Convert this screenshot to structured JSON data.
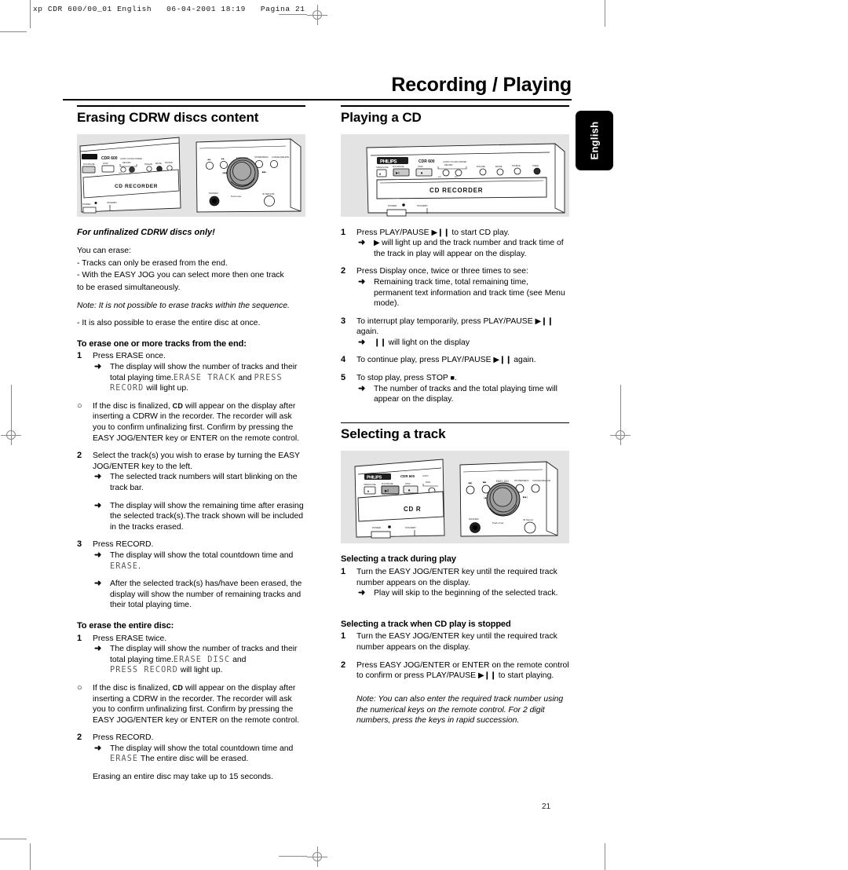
{
  "print_slug": "xp CDR 600/00_01 English   06-04-2001 18:19   Pagina 21",
  "running_head": "Recording / Playing",
  "language_tab": "English",
  "folio": "21",
  "left_column": {
    "section_title": "Erasing CDRW  discs content",
    "figure_name": "cd-recorder-front-panel-split-view",
    "lead": "For unfinalized CDRW discs only!",
    "intro_lines": [
      "You can erase:",
      "- Tracks can only be erased from the end.",
      "- With the EASY JOG you can select more then one track",
      "   to be erased simultaneously."
    ],
    "note_1": "Note: It is not possible to erase tracks within the sequence.",
    "intro_last": "- It is also possible to erase the entire disc at once.",
    "sub_1": "To erase one or more tracks from the end:",
    "s1_num": "1",
    "s1_text": "Press ERASE once.",
    "s1_a_pre": "The display will show the number of tracks and their total playing time.",
    "s1_a_lcd1": "ERASE TRACK",
    "s1_a_mid": " and ",
    "s1_a_lcd2": "PRESS RECORD",
    "s1_a_post": " will light up.",
    "s1_bullet_mark": "○",
    "s1_bullet_pre": "If the disc is finalized, ",
    "s1_bullet_cd": "CD",
    "s1_bullet_post": " will appear on the display after inserting a CDRW in the recorder. The recorder will ask you to confirm unfinalizing first. Confirm by pressing the EASY JOG/ENTER key or ENTER on the remote control.",
    "s2_num": "2",
    "s2_text": "Select the track(s) you wish to erase by turning the EASY JOG/ENTER key to the left.",
    "s2_a": "The selected track numbers will start blinking on the track bar.",
    "s2_b": "The display will show the remaining time after erasing the selected track(s).The track shown will be included in the tracks erased.",
    "s3_num": "3",
    "s3_text": "Press RECORD.",
    "s3_a_pre": "The display will show the total countdown time and ",
    "s3_a_lcd": "ERASE",
    "s3_a_post": ".",
    "s3_b": "After the selected track(s) has/have been erased, the display will show the number of remaining tracks and their total playing time.",
    "sub_2": "To erase the entire disc:",
    "e1_num": "1",
    "e1_text": "Press ERASE twice.",
    "e1_a_pre": "The display will show the number of tracks and their total playing time.",
    "e1_a_lcd1": "ERASE DISC",
    "e1_a_mid": " and",
    "e1_a_lcd2": "PRESS RECORD",
    "e1_a_post": " will light up.",
    "e1_bullet_mark": "○",
    "e1_bullet_pre": "If the disc is finalized, ",
    "e1_bullet_cd": "CD",
    "e1_bullet_post": " will appear on the display after inserting a CDRW in the recorder. The recorder will ask you to confirm unfinalizing first. Confirm by pressing the EASY JOG/ENTER key or ENTER on the remote control.",
    "e2_num": "2",
    "e2_text": "Press RECORD.",
    "e2_a_pre": "The display will show the total countdown time and ",
    "e2_a_lcd": "ERASE",
    "e2_a_post": " The entire disc will be erased.",
    "closing": "Erasing an entire disc may take up to 15 seconds."
  },
  "right_column": {
    "section_title": "Playing a CD",
    "figure_name": "cd-recorder-front-panel-angled",
    "p1_num": "1",
    "p1_pre": "Press PLAY/PAUSE ",
    "p1_glyph": "▶❙❙",
    "p1_post": " to start CD play.",
    "p1_a_glyph": "▶",
    "p1_a_text": " will light up and the track number and track time of the track in play will appear on the display.",
    "p2_num": "2",
    "p2_text": "Press Display once, twice or three times to see:",
    "p2_a": "Remaining track time, total remaining time, permanent text information and track time (see Menu mode).",
    "p3_num": "3",
    "p3_pre": "To interrupt play temporarily, press PLAY/PAUSE ",
    "p3_glyph": "▶❙❙",
    "p3_post": " again.",
    "p3_a_glyph": "❙❙",
    "p3_a_text": " will light on the display",
    "p4_num": "4",
    "p4_pre": "To continue play, press PLAY/PAUSE ",
    "p4_glyph": "▶❙❙",
    "p4_post": " again.",
    "p5_num": "5",
    "p5_pre": "To stop play, press STOP ",
    "p5_glyph": "■",
    "p5_post": ".",
    "p5_a": "The number of tracks and the total playing time will appear on the display.",
    "section_title_2": "Selecting a track",
    "figure_name_2": "cd-recorder-front-panel-split-view-2",
    "sub_1": "Selecting a track during play",
    "t1_num": "1",
    "t1_text": "Turn the EASY JOG/ENTER key until the required track number appears on the display.",
    "t1_a": "Play will skip to the beginning of the selected track.",
    "sub_2": "Selecting a track when CD play is stopped",
    "t2_num": "1",
    "t2_text": "Turn the EASY JOG/ENTER key until the required track number appears on  the display.",
    "t3_num": "2",
    "t3_pre": "Press EASY JOG/ENTER or ENTER on the remote control to confirm or press PLAY/PAUSE ",
    "t3_glyph": "▶❙❙",
    "t3_post": " to start playing.",
    "note": "Note: You can also enter the required track number using the numerical keys on the remote control. For 2 digit numbers, press the keys in rapid succession."
  },
  "panel_labels": {
    "brand": "PHILIPS",
    "model": "CDR 600",
    "model_sub": "AUDIO CD RECORDER",
    "deck": "CD RECORDER",
    "power": "POWER",
    "standby": "STANDBY",
    "open_close": "OPEN/CLOSE",
    "play_pause": "PLAY/PAUSE",
    "stop": "STOP",
    "record": "RECORD",
    "finalize": "FINALIZE",
    "erase": "ERASE",
    "source": "SOURCE",
    "easy_jog": "EASY JOG",
    "store_menu": "STORE/MENU",
    "cancel_delete": "CANCEL/DELETE",
    "phones": "PHONES",
    "push_enter": "PUSH ENTER",
    "ir_sensor": "IR SENSOR"
  }
}
